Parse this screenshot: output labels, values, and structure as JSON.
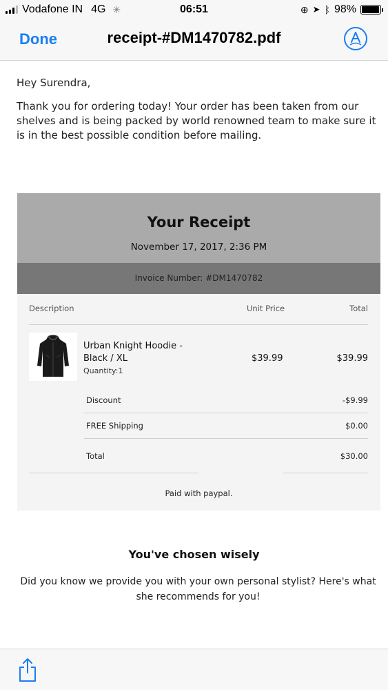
{
  "status_bar": {
    "carrier": "Vodafone IN",
    "network": "4G",
    "time": "06:51",
    "battery": "98%",
    "battery_level": 0.98
  },
  "nav": {
    "done_label": "Done",
    "title": "receipt-#DM1470782.pdf"
  },
  "email": {
    "greeting": "Hey Surendra,",
    "intro": "Thank you for ordering today! Your order has been taken from our shelves and is being packed by world renowned team to make sure it is in the best possible condition before mailing."
  },
  "receipt": {
    "title": "Your Receipt",
    "date": "November 17, 2017, 2:36 PM",
    "invoice": "Invoice Number: #DM1470782",
    "headers": {
      "description": "Description",
      "unit_price": "Unit Price",
      "total": "Total"
    },
    "item": {
      "name": "Urban Knight Hoodie - Black / XL",
      "quantity": "Quantity:1",
      "unit_price": "$39.99",
      "total": "$39.99"
    },
    "summary": [
      {
        "label": "Discount",
        "value": "-$9.99"
      },
      {
        "label": "FREE Shipping",
        "value": "$0.00"
      },
      {
        "label": "Total",
        "value": "$30.00"
      }
    ],
    "paid_with": "Paid with paypal."
  },
  "footer_text": {
    "heading": "You've chosen wisely",
    "stylist": "Did you know we provide you with your own personal stylist? Here's what she recommends for you!"
  },
  "colors": {
    "accent": "#1a7ef5",
    "receipt_header": "#aaaaaa",
    "invoice_bar": "#777777"
  },
  "icons": {
    "markup": "markup-pen-icon",
    "share": "share-icon"
  }
}
